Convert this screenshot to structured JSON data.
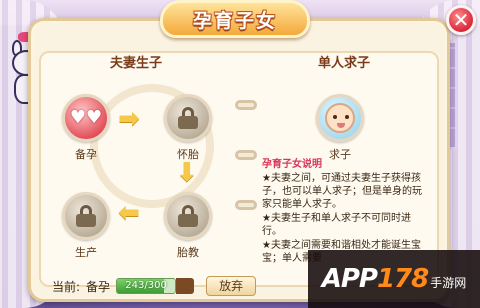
{
  "window": {
    "title": "孕育子女",
    "close_glyph": "✕"
  },
  "couple_section": {
    "title": "夫妻生子",
    "stages": [
      {
        "label": "备孕",
        "state": "active"
      },
      {
        "label": "怀胎",
        "state": "locked"
      },
      {
        "label": "胎教",
        "state": "locked"
      },
      {
        "label": "生产",
        "state": "locked"
      }
    ]
  },
  "single_section": {
    "title": "单人求子",
    "option_label": "求子",
    "description_title": "孕育子女说明",
    "description": [
      "★夫妻之间，可通过夫妻生子获得孩子，也可以单人求子；但是单身的玩家只能单人求子。",
      "★夫妻生子和单人求子不可同时进行。",
      "★夫妻之间需要和谐相处才能诞生宝宝；单人需要"
    ]
  },
  "status_bar": {
    "current_label": "当前:",
    "current_stage": "备孕",
    "progress_text": "243/300",
    "progress_value": 243,
    "progress_max": 300,
    "give_up_label": "放弃"
  },
  "watermark": {
    "brand_main": "APP",
    "brand_num": "178",
    "brand_suffix": "手游网"
  },
  "colors": {
    "accent": "#f4a93b",
    "active_stage": "#e14a55",
    "progress": "#3f9b36"
  },
  "icons": {
    "locked_stage": "lock-icon",
    "active_stage": "hearts-icon",
    "single_option": "baby-icon",
    "arrow": "arrow-icon"
  }
}
